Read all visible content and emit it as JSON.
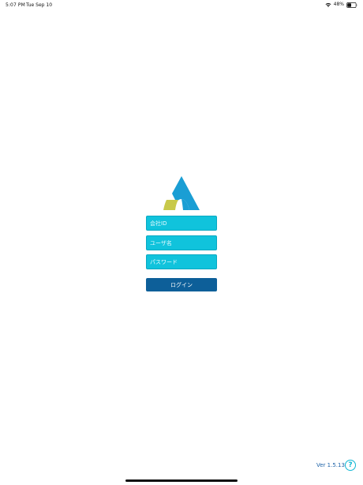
{
  "status_bar": {
    "time": "5:07 PM",
    "date": "Tue Sep 10",
    "battery_percent": "48%",
    "wifi_icon": "wifi-icon",
    "battery_icon": "battery-icon"
  },
  "logo": {
    "icon": "company-logo",
    "colors": {
      "primary": "#1a9ed4",
      "accent": "#c8c94a"
    }
  },
  "form": {
    "company_placeholder": "会社ID",
    "company_value": "",
    "username_placeholder": "ユーザ名",
    "username_value": "",
    "password_placeholder": "パスワード",
    "password_value": "",
    "login_label": "ログイン"
  },
  "footer": {
    "version": "Ver 1.5.13",
    "help_label": "?"
  },
  "colors": {
    "field_background": "#10c3dc",
    "button_background": "#0d5f99",
    "version_text": "#1f63a8",
    "help_icon": "#0fb7d4"
  }
}
